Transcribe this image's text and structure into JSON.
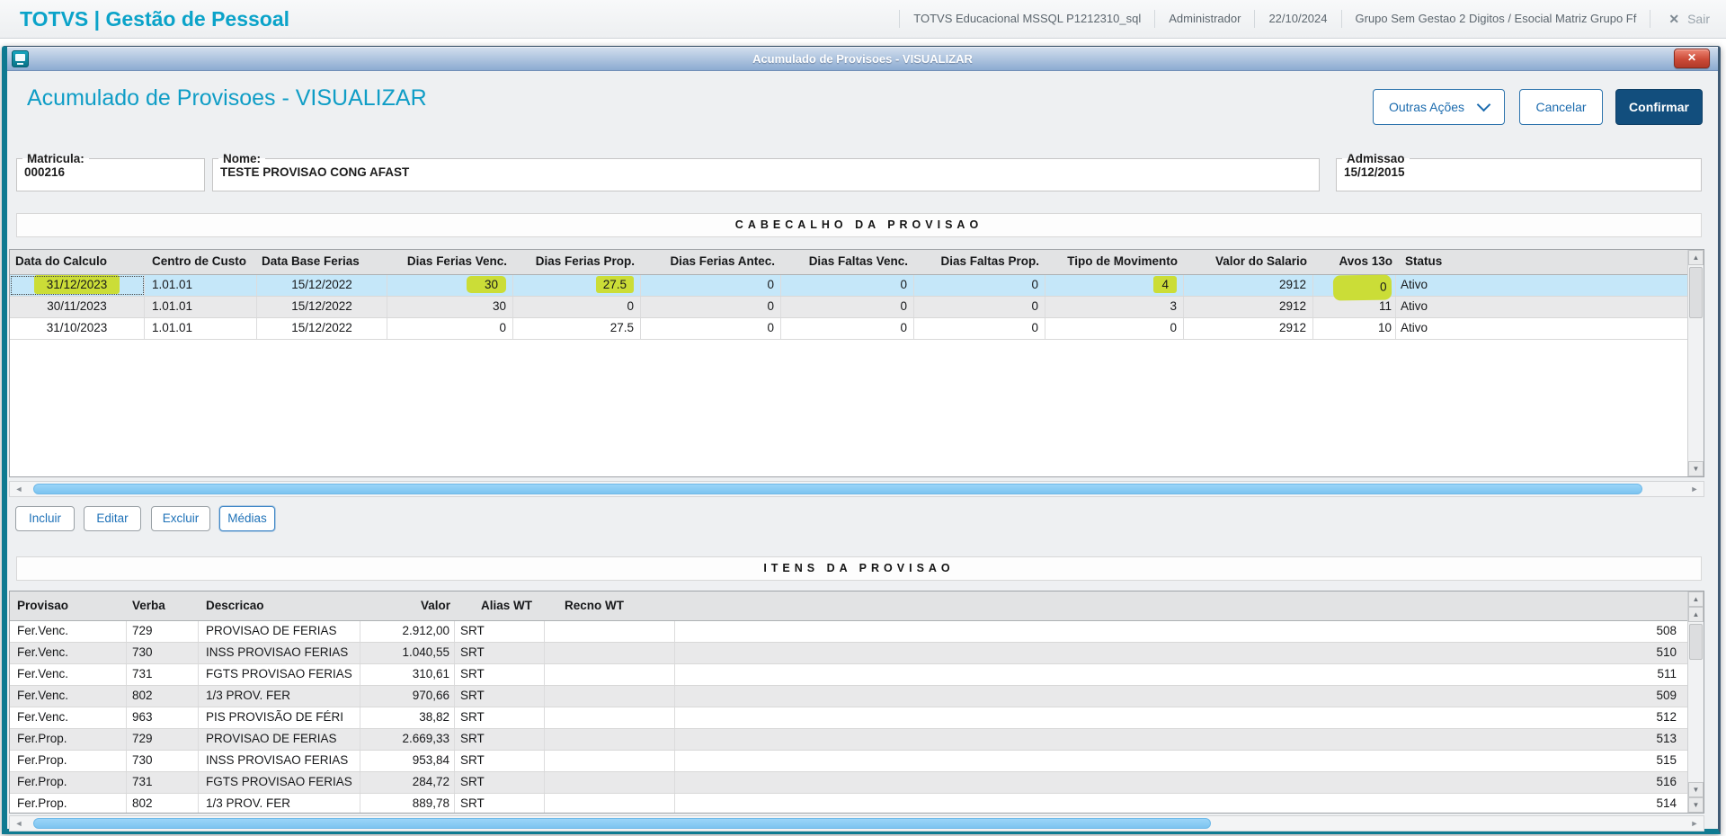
{
  "topbar": {
    "brand": "TOTVS | Gestão de Pessoal",
    "items": [
      "TOTVS Educacional MSSQL P1212310_sql",
      "Administrador",
      "22/10/2024",
      "Grupo Sem Gestao 2 Digitos / Esocial Matriz Grupo Ff"
    ],
    "logout_label": "Sair"
  },
  "icons": {
    "close": "✕",
    "up": "▲",
    "down": "▼",
    "left": "◄",
    "right": "►"
  },
  "window": {
    "title": "Acumulado de Provisoes - VISUALIZAR"
  },
  "page": {
    "heading": "Acumulado de Provisoes - VISUALIZAR",
    "actions": {
      "outras_acoes": "Outras Ações",
      "cancelar": "Cancelar",
      "confirmar": "Confirmar"
    }
  },
  "fields": {
    "matricula": {
      "label": "Matricula:",
      "value": "000216"
    },
    "nome": {
      "label": "Nome:",
      "value": "TESTE PROVISAO CONG AFAST"
    },
    "admissao": {
      "label": "Admissao",
      "value": "15/12/2015"
    }
  },
  "cabecalho": {
    "section_title": "CABECALHO DA PROVISAO",
    "columns": [
      "Data do Calculo",
      "Centro de Custo",
      "Data Base Ferias",
      "Dias Ferias Venc.",
      "Dias Ferias Prop.",
      "Dias Ferias Antec.",
      "Dias Faltas Venc.",
      "Dias Faltas Prop.",
      "Tipo de Movimento",
      "Valor do Salario",
      "Avos 13o",
      "Status"
    ],
    "rows": [
      [
        "31/12/2023",
        "1.01.01",
        "15/12/2022",
        "30",
        "27.5",
        "0",
        "0",
        "0",
        "4",
        "2912",
        "0",
        "Ativo"
      ],
      [
        "30/11/2023",
        "1.01.01",
        "15/12/2022",
        "30",
        "0",
        "0",
        "0",
        "0",
        "3",
        "2912",
        "11",
        "Ativo"
      ],
      [
        "31/10/2023",
        "1.01.01",
        "15/12/2022",
        "0",
        "27.5",
        "0",
        "0",
        "0",
        "0",
        "2912",
        "10",
        "Ativo"
      ]
    ],
    "selected_row": 0,
    "focus_cell": {
      "row": 0,
      "cell": 0
    },
    "annotation_highlights": {
      "row": 0,
      "cells": [
        0,
        3,
        4,
        8,
        10
      ]
    }
  },
  "grid_actions": {
    "incluir": "Incluir",
    "editar": "Editar",
    "excluir": "Excluir",
    "medias": "Médias"
  },
  "itens": {
    "section_title": "ITENS DA PROVISAO",
    "columns": [
      "Provisao",
      "Verba",
      "Descricao",
      "Valor",
      "Alias WT",
      "Recno WT"
    ],
    "rows": [
      [
        "Fer.Venc.",
        "729",
        "PROVISAO DE FERIAS",
        "2.912,00",
        "SRT",
        "",
        "508"
      ],
      [
        "Fer.Venc.",
        "730",
        "INSS PROVISAO FERIAS",
        "1.040,55",
        "SRT",
        "",
        "510"
      ],
      [
        "Fer.Venc.",
        "731",
        "FGTS PROVISAO FERIAS",
        "310,61",
        "SRT",
        "",
        "511"
      ],
      [
        "Fer.Venc.",
        "802",
        "1/3 PROV. FER",
        "970,66",
        "SRT",
        "",
        "509"
      ],
      [
        "Fer.Venc.",
        "963",
        "PIS PROVISÃO DE FÉRI",
        "38,82",
        "SRT",
        "",
        "512"
      ],
      [
        "Fer.Prop.",
        "729",
        "PROVISAO DE FERIAS",
        "2.669,33",
        "SRT",
        "",
        "513"
      ],
      [
        "Fer.Prop.",
        "730",
        "INSS PROVISAO FERIAS",
        "953,84",
        "SRT",
        "",
        "515"
      ],
      [
        "Fer.Prop.",
        "731",
        "FGTS PROVISAO FERIAS",
        "284,72",
        "SRT",
        "",
        "516"
      ],
      [
        "Fer.Prop.",
        "802",
        "1/3 PROV. FER",
        "889,78",
        "SRT",
        "",
        "514"
      ]
    ]
  },
  "colors": {
    "brand_teal": "#0ba3c9",
    "primary_button": "#124e7d",
    "selected_row": "#c5e7f9",
    "annotation_highlight": "#cbdd37",
    "scroll_thumb": "#7cc4f0"
  }
}
